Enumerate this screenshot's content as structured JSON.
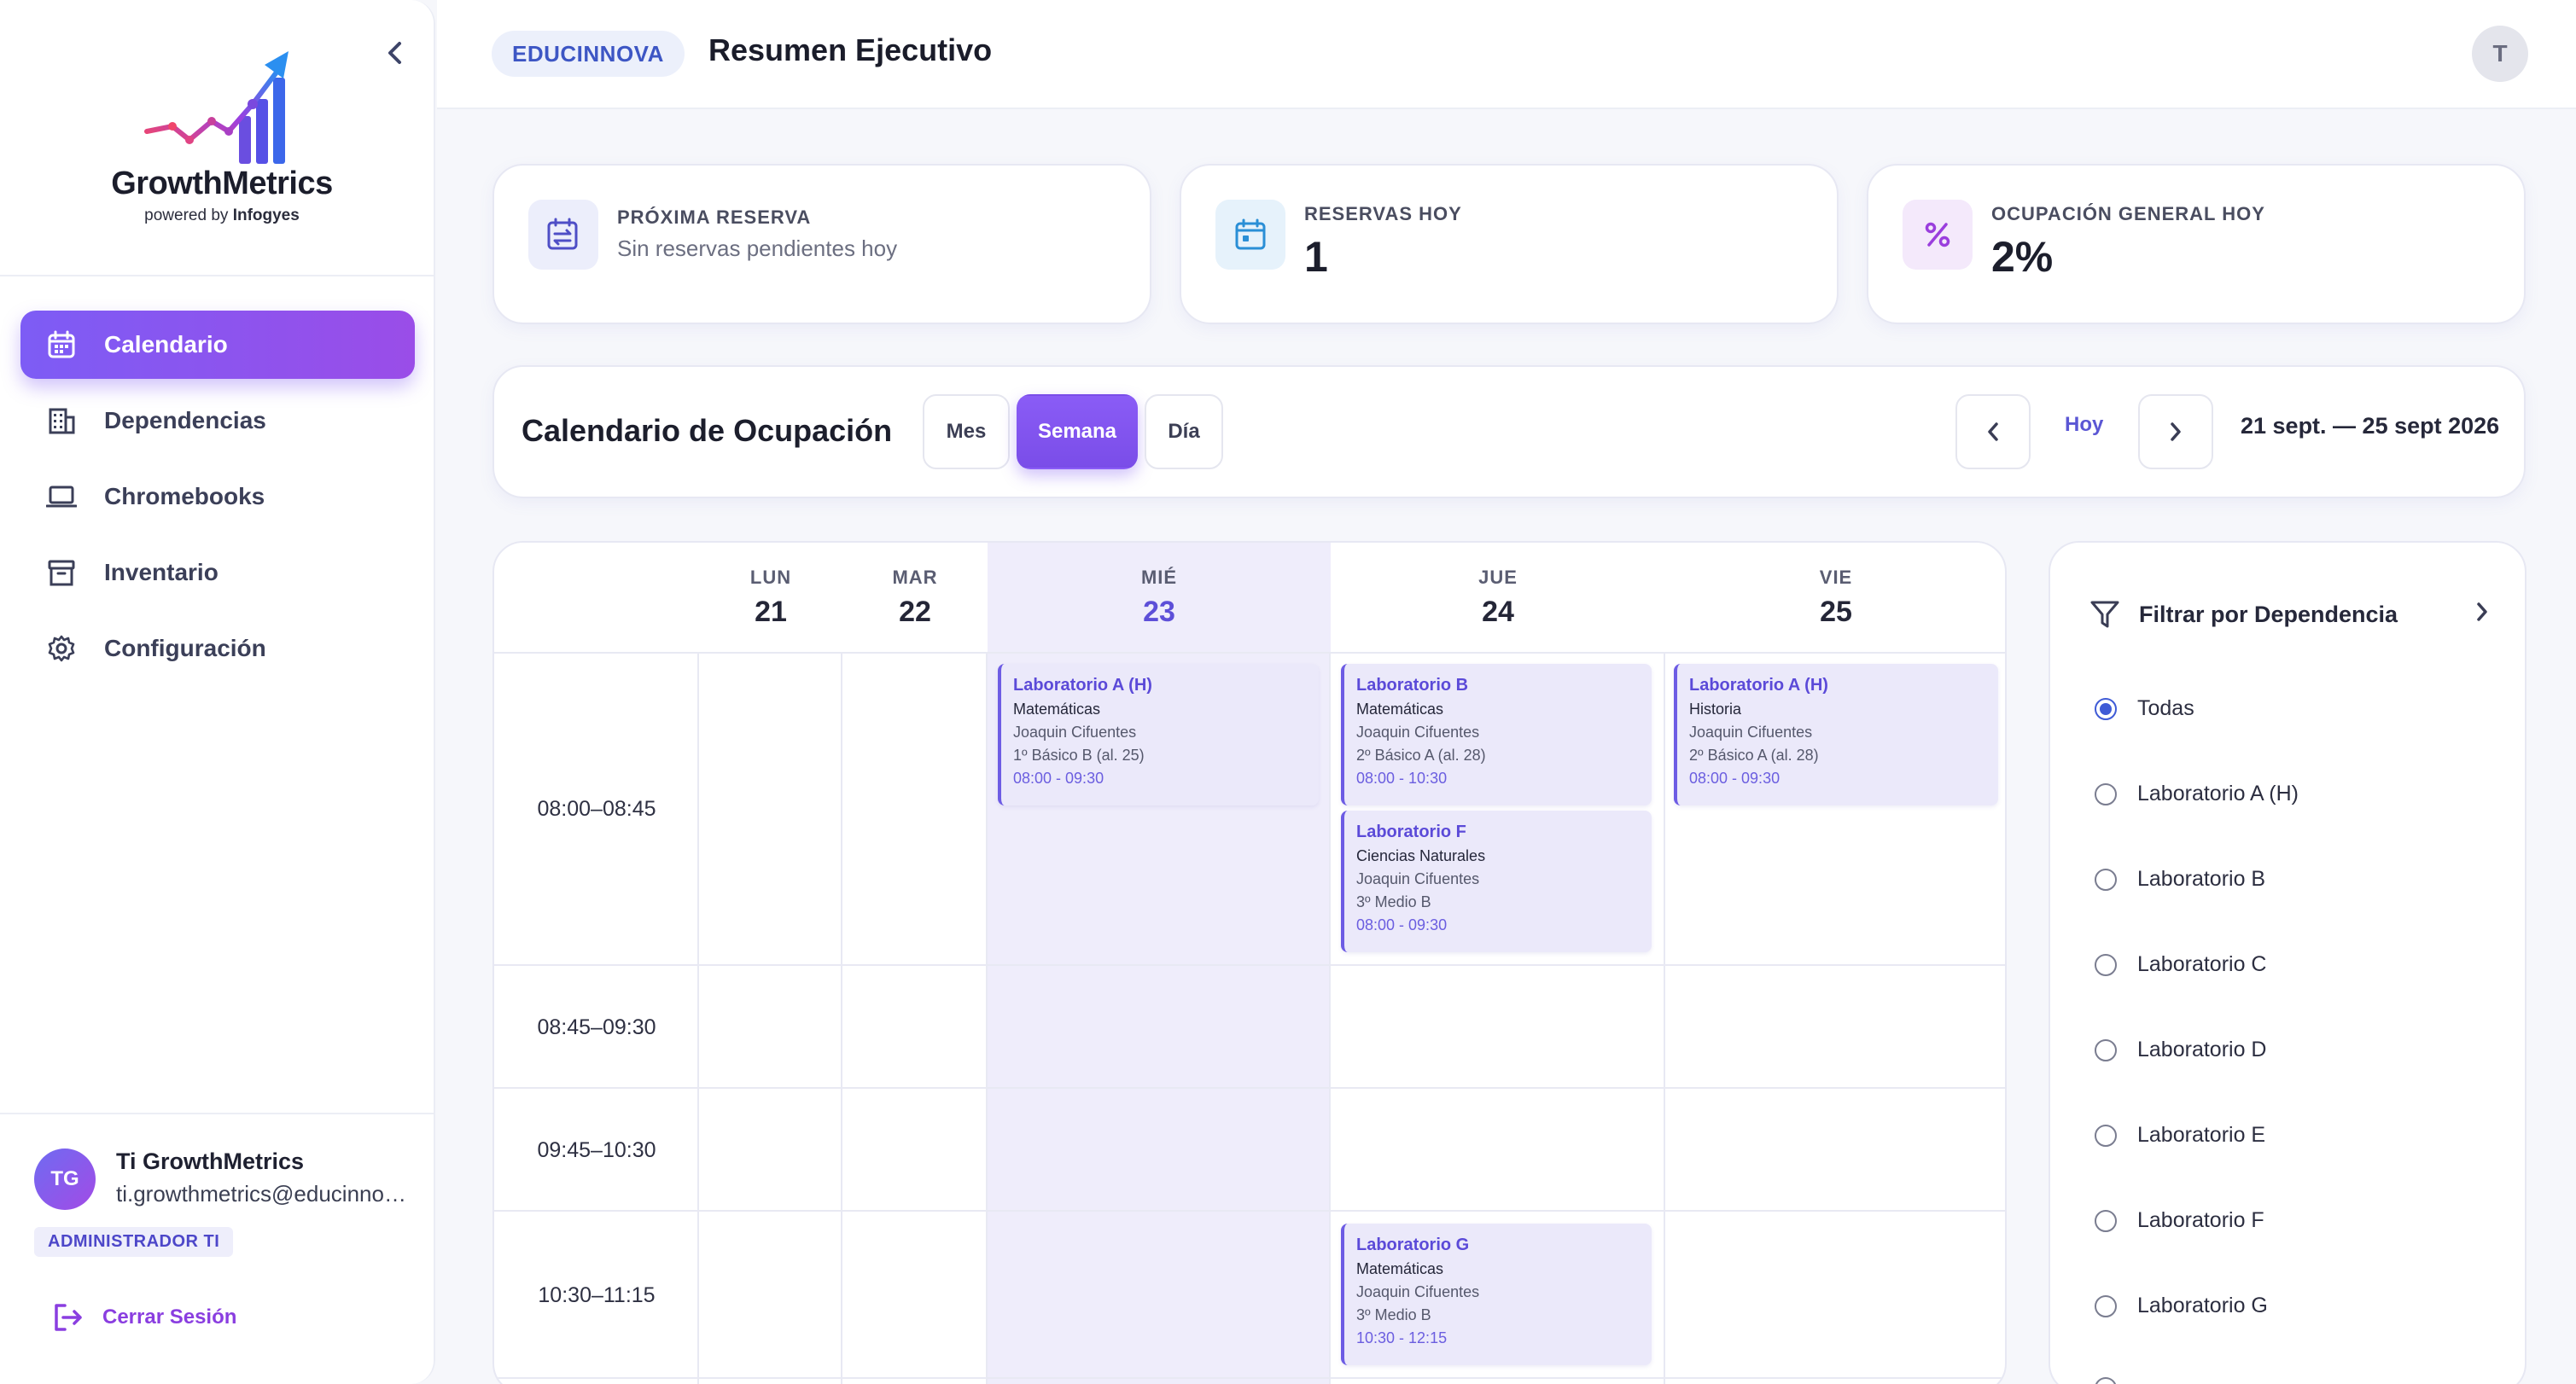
{
  "brand": {
    "name": "GrowthMetrics",
    "powered_prefix": "powered by",
    "powered_brand": "Infogyes"
  },
  "sidebar": {
    "items": [
      {
        "label": "Calendario",
        "icon": "calendar-icon",
        "active": true
      },
      {
        "label": "Dependencias",
        "icon": "building-icon",
        "active": false
      },
      {
        "label": "Chromebooks",
        "icon": "laptop-icon",
        "active": false
      },
      {
        "label": "Inventario",
        "icon": "archive-icon",
        "active": false
      },
      {
        "label": "Configuración",
        "icon": "gear-icon",
        "active": false
      }
    ],
    "user": {
      "initials": "TG",
      "name": "Ti GrowthMetrics",
      "email": "ti.growthmetrics@educinnova.cl",
      "role": "ADMINISTRADOR TI"
    },
    "logout_label": "Cerrar Sesión"
  },
  "header": {
    "org": "EDUCINNOVA",
    "title": "Resumen Ejecutivo",
    "avatar_initial": "T"
  },
  "stats": {
    "next": {
      "label": "PRÓXIMA RESERVA",
      "value": "Sin reservas pendientes hoy"
    },
    "today": {
      "label": "RESERVAS HOY",
      "value": "1"
    },
    "occupancy": {
      "label": "OCUPACIÓN GENERAL HOY",
      "value": "2%"
    }
  },
  "calendar_toolbar": {
    "title": "Calendario de Ocupación",
    "views": [
      "Mes",
      "Semana",
      "Día"
    ],
    "active_view": "Semana",
    "today_label": "Hoy",
    "range": "21 sept. — 25 sept 2026"
  },
  "calendar": {
    "days": [
      {
        "name": "LUN",
        "num": "21"
      },
      {
        "name": "MAR",
        "num": "22"
      },
      {
        "name": "MIÉ",
        "num": "23",
        "today": true
      },
      {
        "name": "JUE",
        "num": "24"
      },
      {
        "name": "VIE",
        "num": "25"
      }
    ],
    "slots": [
      "08:00–08:45",
      "08:45–09:30",
      "09:45–10:30",
      "10:30–11:15"
    ],
    "events": [
      {
        "title": "Laboratorio A (H)",
        "subject": "Matemáticas",
        "teacher": "Joaquin Cifuentes",
        "group": "1º Básico B (al. 25)",
        "time": "08:00 - 09:30"
      },
      {
        "title": "Laboratorio B",
        "subject": "Matemáticas",
        "teacher": "Joaquin Cifuentes",
        "group": "2º Básico A (al. 28)",
        "time": "08:00 - 10:30"
      },
      {
        "title": "Laboratorio F",
        "subject": "Ciencias Naturales",
        "teacher": "Joaquin Cifuentes",
        "group": "3º Medio B",
        "time": "08:00 - 09:30"
      },
      {
        "title": "Laboratorio A (H)",
        "subject": "Historia",
        "teacher": "Joaquin Cifuentes",
        "group": "2º Básico A (al. 28)",
        "time": "08:00 - 09:30"
      },
      {
        "title": "Laboratorio G",
        "subject": "Matemáticas",
        "teacher": "Joaquin Cifuentes",
        "group": "3º Medio B",
        "time": "10:30 - 12:15"
      }
    ]
  },
  "filter": {
    "title": "Filtrar por Dependencia",
    "options": [
      "Todas",
      "Laboratorio A (H)",
      "Laboratorio B",
      "Laboratorio C",
      "Laboratorio D",
      "Laboratorio E",
      "Laboratorio F",
      "Laboratorio G"
    ],
    "selected": "Todas"
  },
  "colors": {
    "accent": "#7d5cf5",
    "accent_dark": "#5b4ad8",
    "today_bg": "#efedfb",
    "logout": "#8a3ee0"
  }
}
